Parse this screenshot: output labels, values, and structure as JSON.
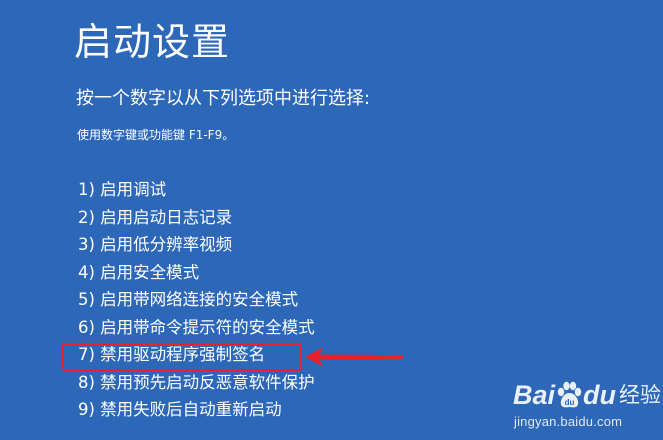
{
  "screen": {
    "title": "启动设置",
    "subtitle": "按一个数字以从下列选项中进行选择:",
    "hint": "使用数字键或功能键 F1-F9。"
  },
  "options": [
    "1) 启用调试",
    "2) 启用启动日志记录",
    "3) 启用低分辨率视频",
    "4) 启用安全模式",
    "5) 启用带网络连接的安全模式",
    "6) 启用带命令提示符的安全模式",
    "7) 禁用驱动程序强制签名",
    "8) 禁用预先启动反恶意软件保护",
    "9) 禁用失败后自动重新启动"
  ],
  "highlight": {
    "selected_index": 7,
    "color": "#e8202a"
  },
  "watermark": {
    "brand_a": "Bai",
    "brand_b": "du",
    "brand_cn": "经验",
    "url": "jingyan.baidu.com",
    "icon": "paw-icon"
  },
  "colors": {
    "background": "#2c67b8",
    "text": "#ffffff",
    "annotation": "#e8202a"
  }
}
